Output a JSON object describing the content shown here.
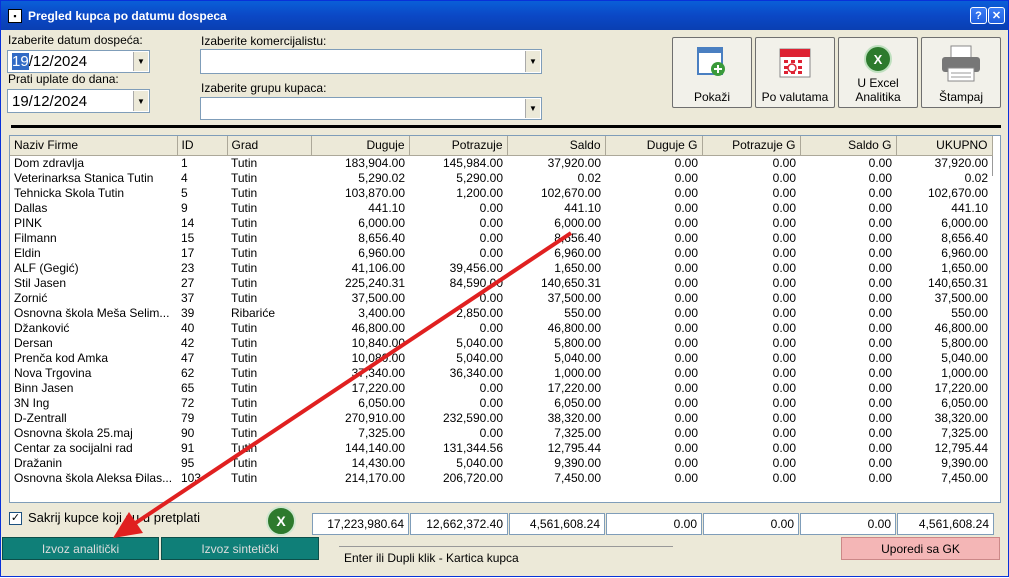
{
  "window": {
    "title": "Pregled kupca po datumu dospeca",
    "help_label": "?",
    "close_label": "✕"
  },
  "filters": {
    "due_date_label": "Izaberite datum dospeća:",
    "due_date_day": "19",
    "due_date_rest": "/12/2024",
    "payment_date_label": "Prati uplate do dana:",
    "payment_date_value": "19/12/2024",
    "salesperson_label": "Izaberite komercijalistu:",
    "salesperson_value": "",
    "customer_group_label": "Izaberite grupu kupaca:",
    "customer_group_value": ""
  },
  "toolbar": {
    "show_label": "Pokaži",
    "currency_label": "Po valutama",
    "excel_label_1": "U Excel",
    "excel_label_2": "Analitika",
    "print_label": "Štampaj"
  },
  "table": {
    "columns": [
      "Naziv Firme",
      "ID",
      "Grad",
      "Duguje",
      "Potrazuje",
      "Saldo",
      "Duguje G",
      "Potrazuje G",
      "Saldo G",
      "UKUPNO"
    ],
    "rows": [
      [
        "Dom zdravlja",
        "1",
        "Tutin",
        "183,904.00",
        "145,984.00",
        "37,920.00",
        "0.00",
        "0.00",
        "0.00",
        "37,920.00"
      ],
      [
        "Veterinarksa Stanica Tutin",
        "4",
        "Tutin",
        "5,290.02",
        "5,290.00",
        "0.02",
        "0.00",
        "0.00",
        "0.00",
        "0.02"
      ],
      [
        "Tehnicka Skola Tutin",
        "5",
        "Tutin",
        "103,870.00",
        "1,200.00",
        "102,670.00",
        "0.00",
        "0.00",
        "0.00",
        "102,670.00"
      ],
      [
        "Dallas",
        "9",
        "Tutin",
        "441.10",
        "0.00",
        "441.10",
        "0.00",
        "0.00",
        "0.00",
        "441.10"
      ],
      [
        "PINK",
        "14",
        "Tutin",
        "6,000.00",
        "0.00",
        "6,000.00",
        "0.00",
        "0.00",
        "0.00",
        "6,000.00"
      ],
      [
        "Filmann",
        "15",
        "Tutin",
        "8,656.40",
        "0.00",
        "8,656.40",
        "0.00",
        "0.00",
        "0.00",
        "8,656.40"
      ],
      [
        "Eldin",
        "17",
        "Tutin",
        "6,960.00",
        "0.00",
        "6,960.00",
        "0.00",
        "0.00",
        "0.00",
        "6,960.00"
      ],
      [
        "ALF (Gegić)",
        "23",
        "Tutin",
        "41,106.00",
        "39,456.00",
        "1,650.00",
        "0.00",
        "0.00",
        "0.00",
        "1,650.00"
      ],
      [
        "Stil Jasen",
        "27",
        "Tutin",
        "225,240.31",
        "84,590.00",
        "140,650.31",
        "0.00",
        "0.00",
        "0.00",
        "140,650.31"
      ],
      [
        "Zornić",
        "37",
        "Tutin",
        "37,500.00",
        "0.00",
        "37,500.00",
        "0.00",
        "0.00",
        "0.00",
        "37,500.00"
      ],
      [
        "Osnovna škola Meša Selim...",
        "39",
        "Ribariće",
        "3,400.00",
        "2,850.00",
        "550.00",
        "0.00",
        "0.00",
        "0.00",
        "550.00"
      ],
      [
        "Džanković",
        "40",
        "Tutin",
        "46,800.00",
        "0.00",
        "46,800.00",
        "0.00",
        "0.00",
        "0.00",
        "46,800.00"
      ],
      [
        "Dersan",
        "42",
        "Tutin",
        "10,840.00",
        "5,040.00",
        "5,800.00",
        "0.00",
        "0.00",
        "0.00",
        "5,800.00"
      ],
      [
        "Prenča kod Amka",
        "47",
        "Tutin",
        "10,080.00",
        "5,040.00",
        "5,040.00",
        "0.00",
        "0.00",
        "0.00",
        "5,040.00"
      ],
      [
        "Nova Trgovina",
        "62",
        "Tutin",
        "37,340.00",
        "36,340.00",
        "1,000.00",
        "0.00",
        "0.00",
        "0.00",
        "1,000.00"
      ],
      [
        "Binn Jasen",
        "65",
        "Tutin",
        "17,220.00",
        "0.00",
        "17,220.00",
        "0.00",
        "0.00",
        "0.00",
        "17,220.00"
      ],
      [
        "3N Ing",
        "72",
        "Tutin",
        "6,050.00",
        "0.00",
        "6,050.00",
        "0.00",
        "0.00",
        "0.00",
        "6,050.00"
      ],
      [
        "D-Zentrall",
        "79",
        "Tutin",
        "270,910.00",
        "232,590.00",
        "38,320.00",
        "0.00",
        "0.00",
        "0.00",
        "38,320.00"
      ],
      [
        "Osnovna škola 25.maj",
        "90",
        "Tutin",
        "7,325.00",
        "0.00",
        "7,325.00",
        "0.00",
        "0.00",
        "0.00",
        "7,325.00"
      ],
      [
        "Centar za socijalni rad",
        "91",
        "Tutin",
        "144,140.00",
        "131,344.56",
        "12,795.44",
        "0.00",
        "0.00",
        "0.00",
        "12,795.44"
      ],
      [
        "Dražanin",
        "95",
        "Tutin",
        "14,430.00",
        "5,040.00",
        "9,390.00",
        "0.00",
        "0.00",
        "0.00",
        "9,390.00"
      ],
      [
        "Osnovna škola Aleksa Đilas...",
        "103",
        "Tutin",
        "214,170.00",
        "206,720.00",
        "7,450.00",
        "0.00",
        "0.00",
        "0.00",
        "7,450.00"
      ]
    ]
  },
  "footer": {
    "hide_prepaid_label": "Sakrij kupce koji su u pretplati",
    "hide_prepaid_checked": true,
    "excel_icon_label": "X",
    "totals": [
      "17,223,980.64",
      "12,662,372.40",
      "4,561,608.24",
      "0.00",
      "0.00",
      "0.00",
      "4,561,608.24"
    ],
    "export_analytic_label": "Izvoz analitički",
    "export_synthetic_label": "Izvoz sintetički",
    "status_text": "Enter ili Dupli klik - Kartica kupca",
    "compare_gk_label": "Uporedi sa GK"
  },
  "colors": {
    "annotation_arrow": "#e02020",
    "teal_button": "#0f7f78",
    "pink_button": "#f4b6b6"
  }
}
